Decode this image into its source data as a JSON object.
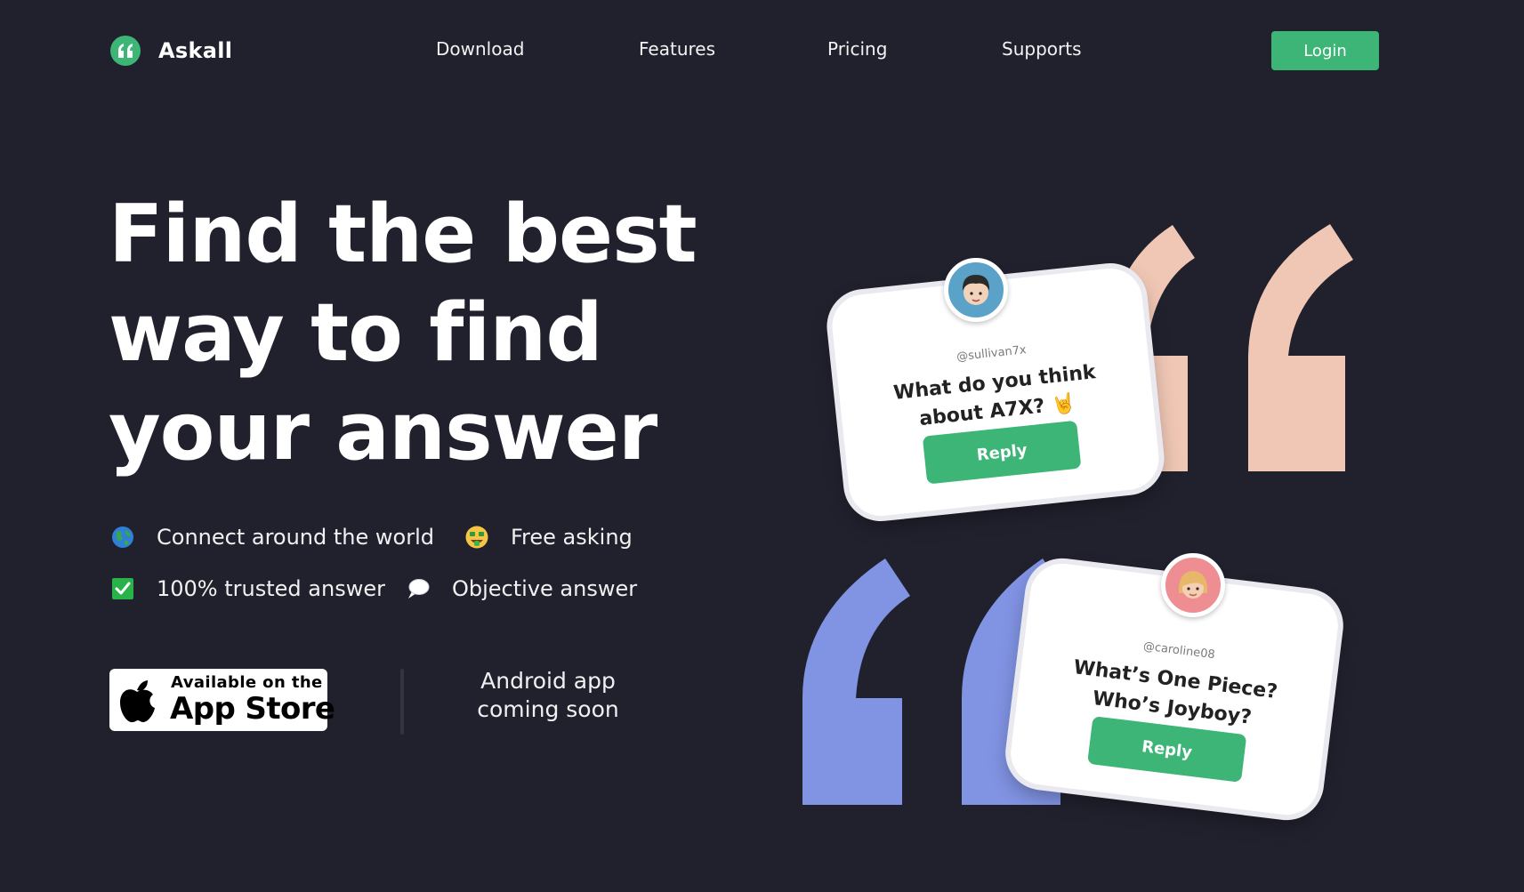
{
  "nav": {
    "brand": "Askall",
    "links": [
      "Download",
      "Features",
      "Pricing",
      "Supports"
    ],
    "login": "Login"
  },
  "hero": {
    "headline_lines": [
      "Find the best",
      "way to find",
      "your answer"
    ],
    "features": [
      {
        "label": "Connect around the world",
        "icon": "globe-icon"
      },
      {
        "label": "Free asking",
        "icon": "money-face-icon"
      },
      {
        "label": "100% trusted answer",
        "icon": "check-box-icon"
      },
      {
        "label": "Objective answer",
        "icon": "speech-bubble-icon"
      }
    ],
    "appstore": {
      "small": "Available on the",
      "big": "App Store"
    },
    "android": [
      "Android app",
      "coming soon"
    ]
  },
  "cards": [
    {
      "handle": "@sullivan7x",
      "question_lines": [
        "What do you think",
        "about A7X? 🤘"
      ],
      "reply": "Reply"
    },
    {
      "handle": "@caroline08",
      "question_lines": [
        "What’s One Piece?",
        "Who’s Joyboy?"
      ],
      "reply": "Reply"
    }
  ],
  "colors": {
    "background": "#20212d",
    "accent": "#3cb576",
    "quote_peach": "#f0c7b5",
    "quote_blue": "#8193e3"
  }
}
